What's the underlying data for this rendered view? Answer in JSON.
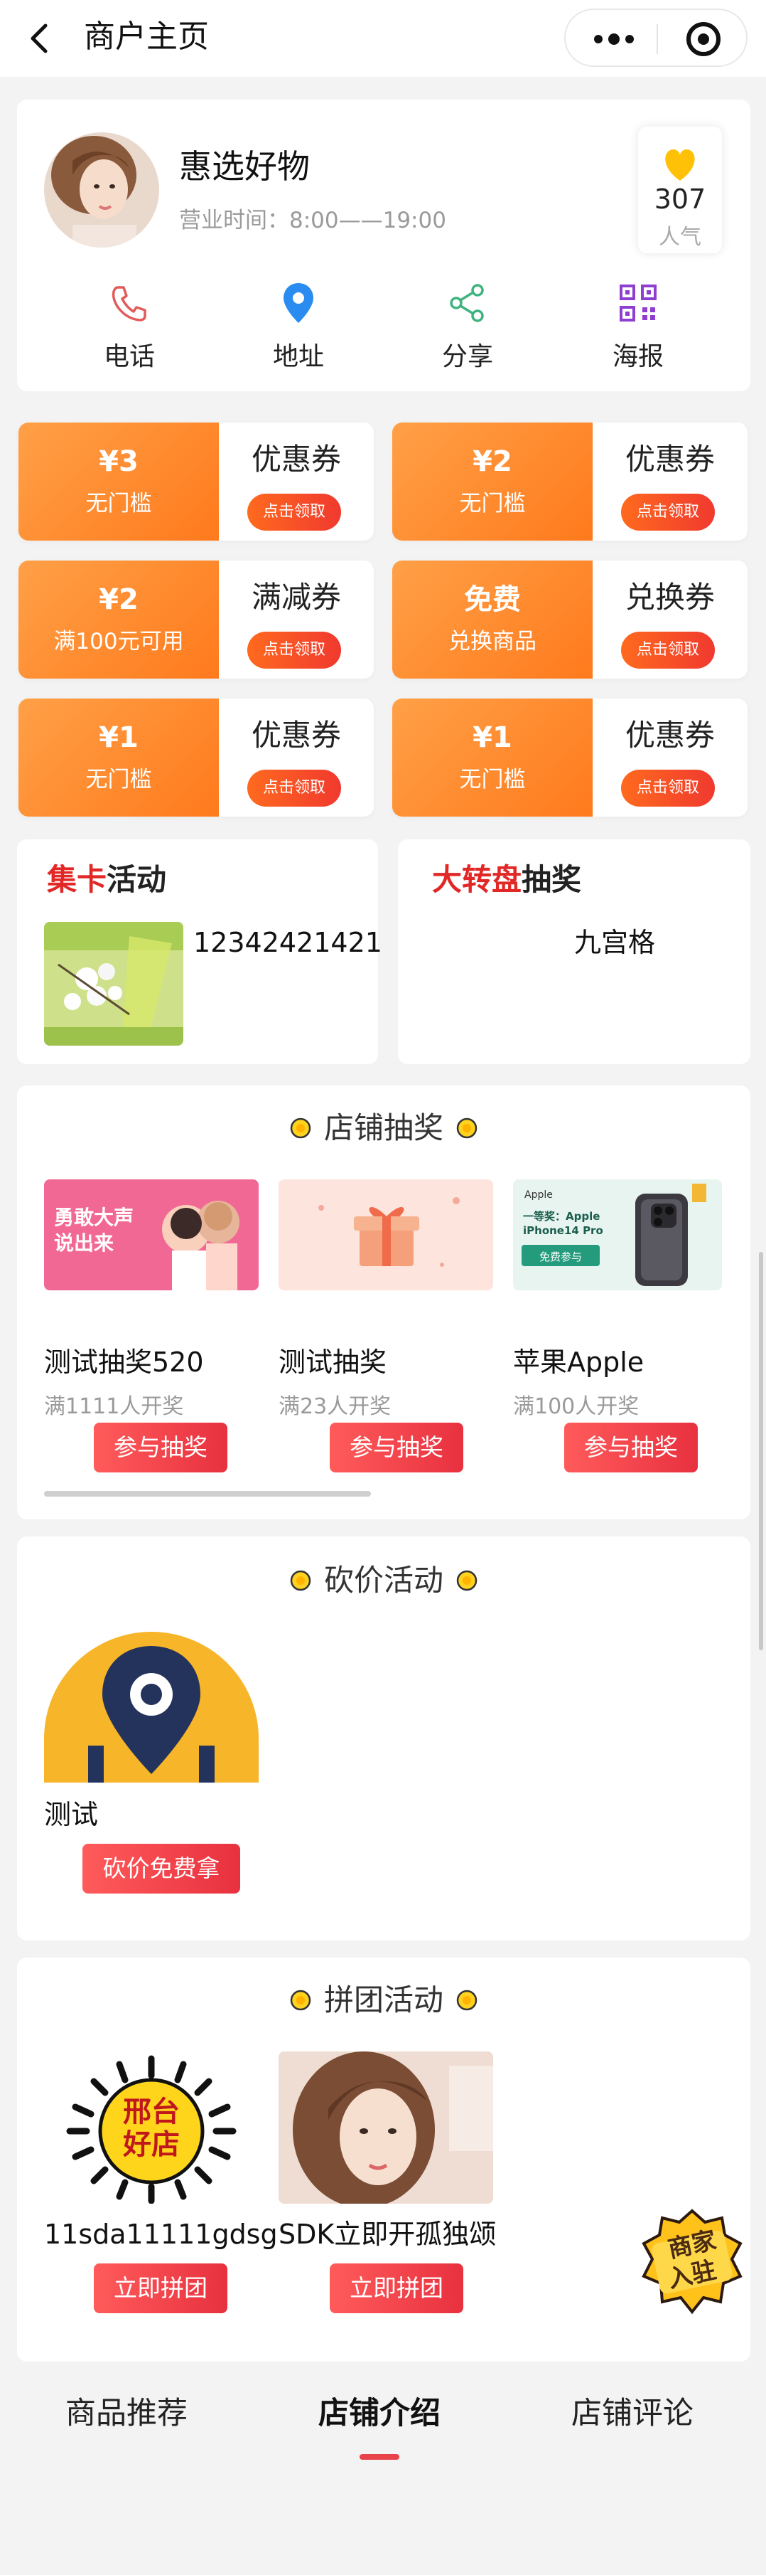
{
  "nav": {
    "title": "商户主页"
  },
  "shop": {
    "name": "惠选好物",
    "hours_label": "营业时间：",
    "hours_value": "8:00——19:00",
    "popularity_count": "307",
    "popularity_label": "人气",
    "actions": [
      {
        "label": "电话",
        "icon": "phone-icon"
      },
      {
        "label": "地址",
        "icon": "location-pin-icon"
      },
      {
        "label": "分享",
        "icon": "share-icon"
      },
      {
        "label": "海报",
        "icon": "qr-poster-icon"
      }
    ]
  },
  "coupons": [
    {
      "amount": "¥3",
      "condition": "无门槛",
      "type": "优惠券",
      "claim": "点击领取"
    },
    {
      "amount": "¥2",
      "condition": "无门槛",
      "type": "优惠券",
      "claim": "点击领取"
    },
    {
      "amount": "¥2",
      "condition": "满100元可用",
      "type": "满减券",
      "claim": "点击领取"
    },
    {
      "amount": "免费",
      "condition": "兑换商品",
      "type": "兑换券",
      "claim": "点击领取"
    },
    {
      "amount": "¥1",
      "condition": "无门槛",
      "type": "优惠券",
      "claim": "点击领取"
    },
    {
      "amount": "¥1",
      "condition": "无门槛",
      "type": "优惠券",
      "claim": "点击领取"
    }
  ],
  "card_activity": {
    "title_highlight": "集卡",
    "title_rest": "活动",
    "item_text": "12342421421"
  },
  "wheel_activity": {
    "title_highlight": "大转盘",
    "title_rest": "抽奖",
    "item_text": "九宫格"
  },
  "lottery": {
    "header": "店铺抽奖",
    "items": [
      {
        "name": "测试抽奖520",
        "sub": "满1111人开奖",
        "button": "参与抽奖",
        "image_text": "勇敢大声说出来"
      },
      {
        "name": "测试抽奖",
        "sub": "满23人开奖",
        "button": "参与抽奖",
        "image_text": ""
      },
      {
        "name": "苹果Apple",
        "sub": "满100人开奖",
        "button": "参与抽奖",
        "image_text": "一等奖：Apple iPhone14 Pro"
      }
    ],
    "image_sub": {
      "apple_brand": "Apple",
      "apple_free": "免费参与"
    }
  },
  "bargain": {
    "header": "砍价活动",
    "items": [
      {
        "name": "测试",
        "button": "砍价免费拿"
      }
    ]
  },
  "group": {
    "header": "拼团活动",
    "items": [
      {
        "name": "11sda11111gdsg",
        "button": "立即拼团",
        "image_text": "邢台好店"
      },
      {
        "name": "SDK立即开孤独颂",
        "button": "立即拼团",
        "image_text": ""
      }
    ]
  },
  "float_badge": {
    "text_line1": "商家",
    "text_line2": "入驻"
  },
  "tabs": [
    {
      "label": "商品推荐",
      "active": false
    },
    {
      "label": "店铺介绍",
      "active": true
    },
    {
      "label": "店铺评论",
      "active": false
    }
  ],
  "colors": {
    "accent_red": "#e22727",
    "coupon_orange": "#ff8a2a",
    "button_red": "#e8313f",
    "popularity_heart": "#ffc107"
  }
}
